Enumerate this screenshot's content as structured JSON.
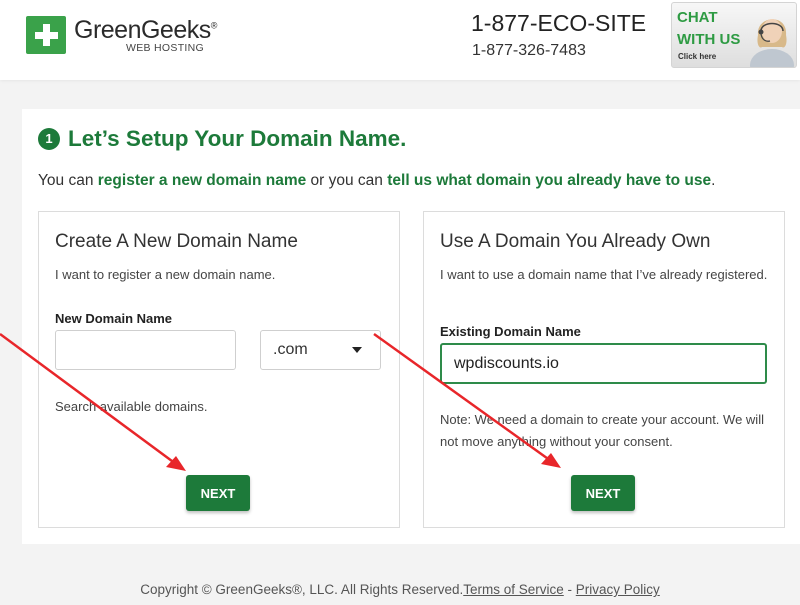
{
  "header": {
    "logo_name": "GreenGeeks",
    "logo_registered": "®",
    "logo_sub": "WEB HOSTING",
    "phone_vanity": "1-877-ECO-SITE",
    "phone_number": "1-877-326-7483",
    "chat": {
      "line1": "CHAT",
      "line2": "WITH US",
      "click": "Click here"
    }
  },
  "step": {
    "number": "1",
    "title": "Let’s Setup Your Domain Name.",
    "intro_prefix": "You can ",
    "intro_link1": "register a new domain name",
    "intro_middle": " or you can ",
    "intro_link2": "tell us what domain you already have to use",
    "intro_suffix": "."
  },
  "new_domain": {
    "heading": "Create A New Domain Name",
    "description": "I want to register a new domain name.",
    "field_label": "New Domain Name",
    "input_value": "",
    "tld_selected": ".com",
    "helper": "Search available domains.",
    "button": "NEXT"
  },
  "existing_domain": {
    "heading": "Use A Domain You Already Own",
    "description": "I want to use a domain name that I’ve already registered.",
    "field_label": "Existing Domain Name",
    "input_value": "wpdiscounts.io",
    "note": "Note: We need a domain to create your account. We will not move anything without your consent.",
    "button": "NEXT"
  },
  "footer": {
    "copyright": "Copyright © GreenGeeks®, LLC. All Rights Reserved.",
    "terms": "Terms of Service",
    "separator": " - ",
    "privacy": "Privacy Policy"
  },
  "colors": {
    "brand_green": "#1d7a3a",
    "logo_green": "#3aa24a",
    "annotation_arrow": "#e8262a"
  },
  "icons": {
    "logo": "plus-icon",
    "select_caret": "caret-down-icon",
    "annotation": "red-arrow-icon"
  }
}
